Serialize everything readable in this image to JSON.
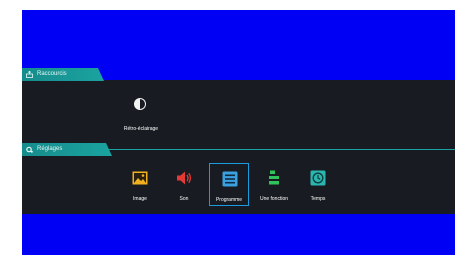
{
  "sections": {
    "shortcuts_label": "Raccourcis",
    "settings_label": "Réglages"
  },
  "shortcuts": [
    {
      "label": "Rétro-éclairage",
      "icon": "half-moon-icon"
    }
  ],
  "settings": [
    {
      "label": "Image",
      "icon": "picture-icon",
      "color": "#f0b020"
    },
    {
      "label": "Son",
      "icon": "speaker-icon",
      "color": "#e53935"
    },
    {
      "label": "Programme",
      "icon": "program-list-icon",
      "color": "#3aa0e0",
      "selected": true
    },
    {
      "label": "Une fonction",
      "icon": "function-icon",
      "color": "#2ec45a"
    },
    {
      "label": "Temps",
      "icon": "clock-icon",
      "color": "#2bb5b0"
    }
  ],
  "colors": {
    "background": "#0000f5",
    "panel": "#181c22",
    "accent": "#1aa3a0",
    "selection": "#1c9adf"
  }
}
